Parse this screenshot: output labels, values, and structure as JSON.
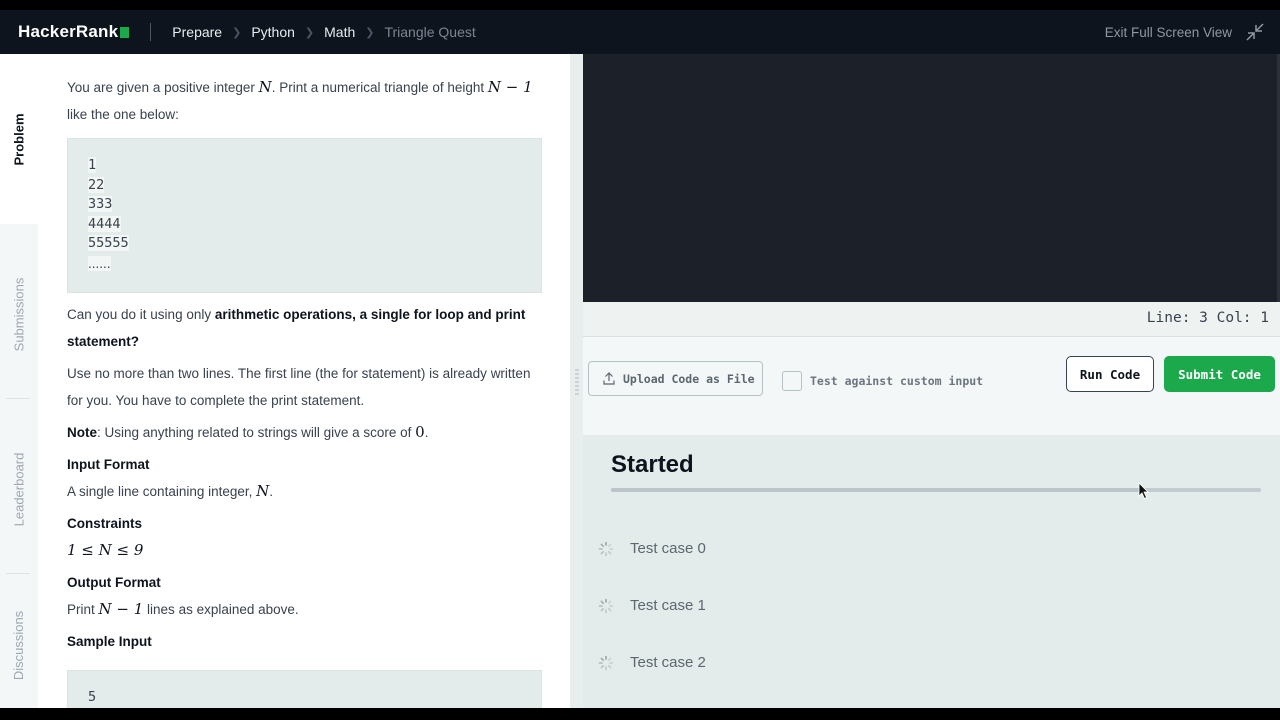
{
  "header": {
    "logo": "HackerRank",
    "brand_color": "#1ba94c",
    "breadcrumbs": [
      {
        "label": "Prepare"
      },
      {
        "label": "Python"
      },
      {
        "label": "Math"
      },
      {
        "label": "Triangle Quest"
      }
    ],
    "exit_label": "Exit Full Screen View",
    "exit_icon": "compress-icon"
  },
  "vtabs": [
    "Problem",
    "Submissions",
    "Leaderboard",
    "Discussions"
  ],
  "problem": {
    "intro_a": "You are given a positive integer ",
    "intro_n": "N",
    "intro_b": ". Print a numerical triangle of height ",
    "intro_expr": "N − 1",
    "intro_c": "like the one below:",
    "triangle": [
      "1",
      "22",
      "333",
      "4444",
      "55555",
      "......"
    ],
    "q_a": "Can you do it using only ",
    "q_bold": "arithmetic operations, a single for loop and print statement?",
    "use_text": "Use no more than two lines. The first line (the for statement) is already written for you. You have to complete the print statement.",
    "note_label": "Note",
    "note_text": ": Using anything related to strings will give a score of ",
    "note_zero": "0",
    "note_end": ".",
    "input_heading": "Input Format",
    "input_text": "A single line containing integer, ",
    "input_n": "N",
    "input_end": ".",
    "constraints_heading": "Constraints",
    "constraint": "1 ≤ N ≤ 9",
    "output_heading": "Output Format",
    "output_a": "Print ",
    "output_expr": "N − 1",
    "output_b": " lines as explained above.",
    "sample_heading": "Sample Input",
    "sample_value": "5"
  },
  "editor": {
    "status": "Line: 3 Col: 1"
  },
  "actions": {
    "upload_label": "Upload Code as File",
    "custom_input_label": "Test against custom input",
    "run_label": "Run Code",
    "submit_label": "Submit Code"
  },
  "results": {
    "status": "Started",
    "progress_fraction": 0.82,
    "test_cases": [
      "Test case 0",
      "Test case 1",
      "Test case 2"
    ]
  }
}
